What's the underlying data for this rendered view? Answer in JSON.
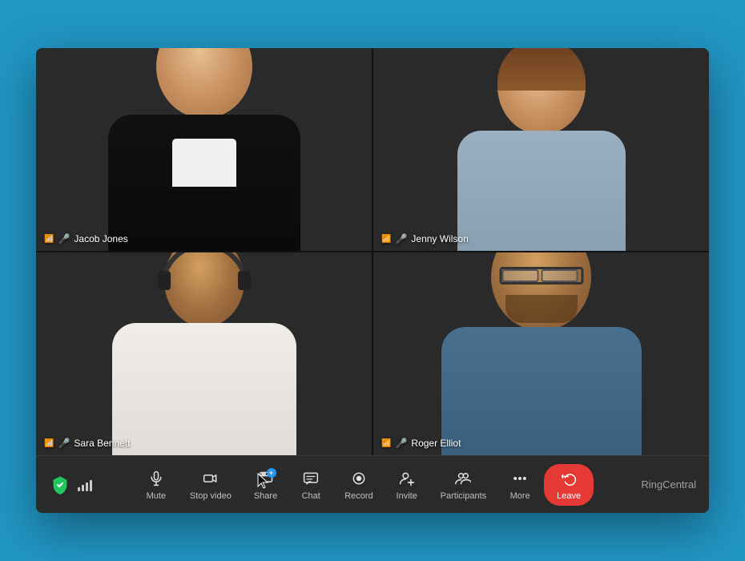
{
  "app": {
    "brand": "RingCentral",
    "background_color": "#2196C4"
  },
  "participants": [
    {
      "id": "jacob-jones",
      "name": "Jacob Jones",
      "position": "top-left",
      "has_mic": true,
      "has_signal": true
    },
    {
      "id": "jenny-wilson",
      "name": "Jenny Wilson",
      "position": "top-right",
      "has_mic": true,
      "has_signal": true
    },
    {
      "id": "sara-bennett",
      "name": "Sara Bennett",
      "position": "bottom-left",
      "has_mic": true,
      "has_signal": true
    },
    {
      "id": "roger-elliot",
      "name": "Roger Elliot",
      "position": "bottom-right",
      "has_mic": true,
      "has_signal": true
    }
  ],
  "toolbar": {
    "buttons": [
      {
        "id": "mute",
        "label": "Mute",
        "icon": "mic"
      },
      {
        "id": "stop-video",
        "label": "Stop video",
        "icon": "video"
      },
      {
        "id": "share",
        "label": "Share",
        "icon": "share"
      },
      {
        "id": "chat",
        "label": "Chat",
        "icon": "chat"
      },
      {
        "id": "record",
        "label": "Record",
        "icon": "record"
      },
      {
        "id": "invite",
        "label": "Invite",
        "icon": "invite"
      },
      {
        "id": "participants",
        "label": "Participants",
        "icon": "participants"
      },
      {
        "id": "more",
        "label": "More",
        "icon": "more"
      },
      {
        "id": "leave",
        "label": "Leave",
        "icon": "phone"
      }
    ],
    "mute_label": "Mute",
    "stop_video_label": "Stop video",
    "share_label": "Share",
    "chat_label": "Chat",
    "record_label": "Record",
    "invite_label": "Invite",
    "participants_label": "Participants",
    "more_label": "More",
    "leave_label": "Leave"
  }
}
